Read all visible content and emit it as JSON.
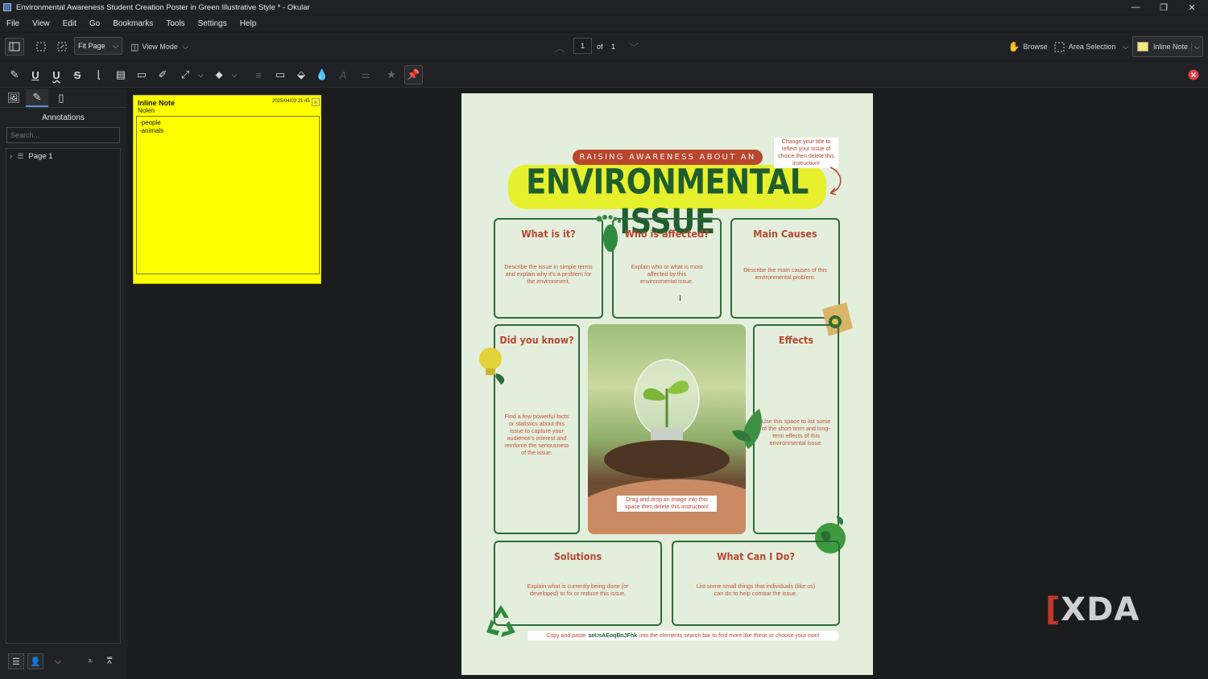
{
  "window": {
    "title": "Environmental Awareness Student Creation Poster in Green Illustrative Style * - Okular",
    "minimize": "—",
    "restore": "❐",
    "close": "✕"
  },
  "menu": [
    "File",
    "View",
    "Edit",
    "Go",
    "Bookmarks",
    "Tools",
    "Settings",
    "Help"
  ],
  "toolbar": {
    "zoom_mode": "Fit Page",
    "view_mode": "View Mode",
    "page_current": "1",
    "page_of": "of",
    "page_total": "1",
    "browse": "Browse",
    "area_selection": "Area Selection",
    "inline_note": "Inline Note"
  },
  "sidebar": {
    "heading": "Annotations",
    "search_placeholder": "Search...",
    "tree_item": "Page 1"
  },
  "note": {
    "title": "Inline Note",
    "author": "Nolen",
    "date": "2025/04/03 21:45",
    "line1": "-people",
    "line2": "-animals"
  },
  "poster": {
    "kicker": "RAISING AWARENESS ABOUT AN",
    "title": "ENVIRONMENTAL ISSUE",
    "title_instruction": "Change your title to reflect your issue of choice then delete this instruction!",
    "cards": [
      {
        "title": "What is it?",
        "body": "Describe the issue in simple terms and explain why it's a problem for the environment."
      },
      {
        "title": "Who is affected?",
        "body": "Explain who or what is most affected by this environmental issue."
      },
      {
        "title": "Main Causes",
        "body": "Describe the main causes of this environmental problem."
      },
      {
        "title": "Did you know?",
        "body": "Find a few powerful facts or statistics about this issue to capture your audience's interest and reinforce the seriousness of the issue."
      },
      {
        "title": "Effects",
        "body": "Use this space to list some of the short-term and long-term effects of this environmental issue."
      },
      {
        "title": "Solutions",
        "body": "Explain what is currently being done (or developed) to fix or reduce this issue."
      },
      {
        "title": "What Can I Do?",
        "body": "List some small things that individuals (like us) can do to help combat the issue."
      }
    ],
    "photo_instruction": "Drag and drop an image into this space then delete this instruction!",
    "footer_pre": "Copy and paste",
    "footer_code": "set:nAEoqBnJFhk",
    "footer_post": "into the elements search bar to find more like these or choose your own!"
  },
  "watermark": "XDA",
  "colors": {
    "poster_bg": "#e4eedc",
    "accent_green": "#1f5d2e",
    "accent_red": "#b5482f",
    "highlight_yellow": "#e6f02c",
    "note_yellow": "#ffff00"
  }
}
